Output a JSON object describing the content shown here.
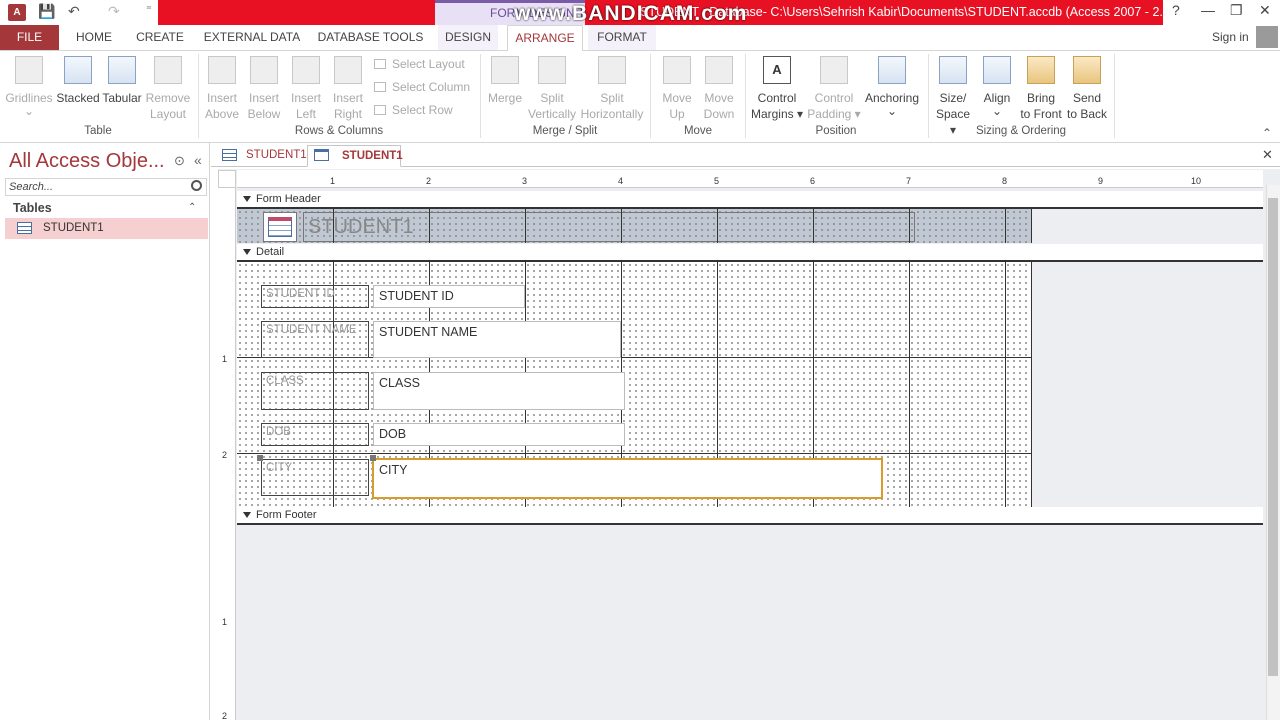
{
  "titlebar": {
    "app_icon": "A",
    "context_label": "FORM DESIGN T",
    "watermark": "www.BANDICAM.com",
    "window_title": "STUDENT : Database- C:\\Users\\Sehrish Kabir\\Documents\\STUDENT.accdb (Access 2007 - 2...",
    "help": "?",
    "minimize": "—",
    "restore": "❐",
    "close": "✕",
    "qat_save": "💾",
    "qat_undo": "↶",
    "qat_redo": "↷",
    "qat_more": "⁼"
  },
  "tabs": [
    "FILE",
    "HOME",
    "CREATE",
    "EXTERNAL DATA",
    "DATABASE TOOLS",
    "DESIGN",
    "ARRANGE",
    "FORMAT"
  ],
  "signin": "Sign in",
  "ribbon": {
    "table_group": {
      "label": "Table",
      "gridlines": [
        "Gridlines",
        "⌄"
      ],
      "stacked": "Stacked",
      "tabular": "Tabular",
      "remove_layout": [
        "Remove",
        "Layout"
      ]
    },
    "rows_columns": {
      "label": "Rows & Columns",
      "insert_above": [
        "Insert",
        "Above"
      ],
      "insert_below": [
        "Insert",
        "Below"
      ],
      "insert_left": [
        "Insert",
        "Left"
      ],
      "insert_right": [
        "Insert",
        "Right"
      ],
      "select_layout": "Select Layout",
      "select_column": "Select Column",
      "select_row": "Select Row"
    },
    "merge_split": {
      "label": "Merge / Split",
      "merge": "Merge",
      "split_v": [
        "Split",
        "Vertically"
      ],
      "split_h": [
        "Split",
        "Horizontally"
      ]
    },
    "move": {
      "label": "Move",
      "move_up": [
        "Move",
        "Up"
      ],
      "move_down": [
        "Move",
        "Down"
      ]
    },
    "position": {
      "label": "Position",
      "control_margins": [
        "Control",
        "Margins ▾"
      ],
      "control_padding": [
        "Control",
        "Padding ▾"
      ],
      "anchoring": [
        "Anchoring",
        "⌄"
      ]
    },
    "sizing": {
      "label": "Sizing & Ordering",
      "size_space": [
        "Size/",
        "Space ▾"
      ],
      "align": [
        "Align",
        "⌄"
      ],
      "bring_front": [
        "Bring",
        "to Front"
      ],
      "send_back": [
        "Send",
        "to Back"
      ],
      "collapse": "⌃"
    }
  },
  "nav": {
    "title": "All Access Obje...",
    "search_placeholder": "Search...",
    "group": "Tables",
    "item": "STUDENT1",
    "dropdown": "⊙",
    "collapse": "«",
    "group_toggle": "⌃"
  },
  "doctabs": [
    "STUDENT1",
    "STUDENT1"
  ],
  "doctab_close": "✕",
  "ruler_h": [
    "1",
    "2",
    "3",
    "4",
    "5",
    "6",
    "7",
    "8",
    "9",
    "10"
  ],
  "ruler_v": [
    "1",
    "2",
    "1",
    "2"
  ],
  "sections": {
    "header": "Form Header",
    "detail": "Detail",
    "footer": "Form Footer"
  },
  "form_title": "STUDENT1",
  "controls": [
    {
      "label": "STUDENT ID",
      "field": "STUDENT ID"
    },
    {
      "label": "STUDENT NAME",
      "field": "STUDENT NAME"
    },
    {
      "label": "CLASS",
      "field": "CLASS"
    },
    {
      "label": "DOB",
      "field": "DOB"
    },
    {
      "label": "CITY",
      "field": "CITY"
    }
  ],
  "colors": {
    "accent": "#a4373a",
    "selection": "#d99b2b",
    "title_band": "#e81123"
  }
}
